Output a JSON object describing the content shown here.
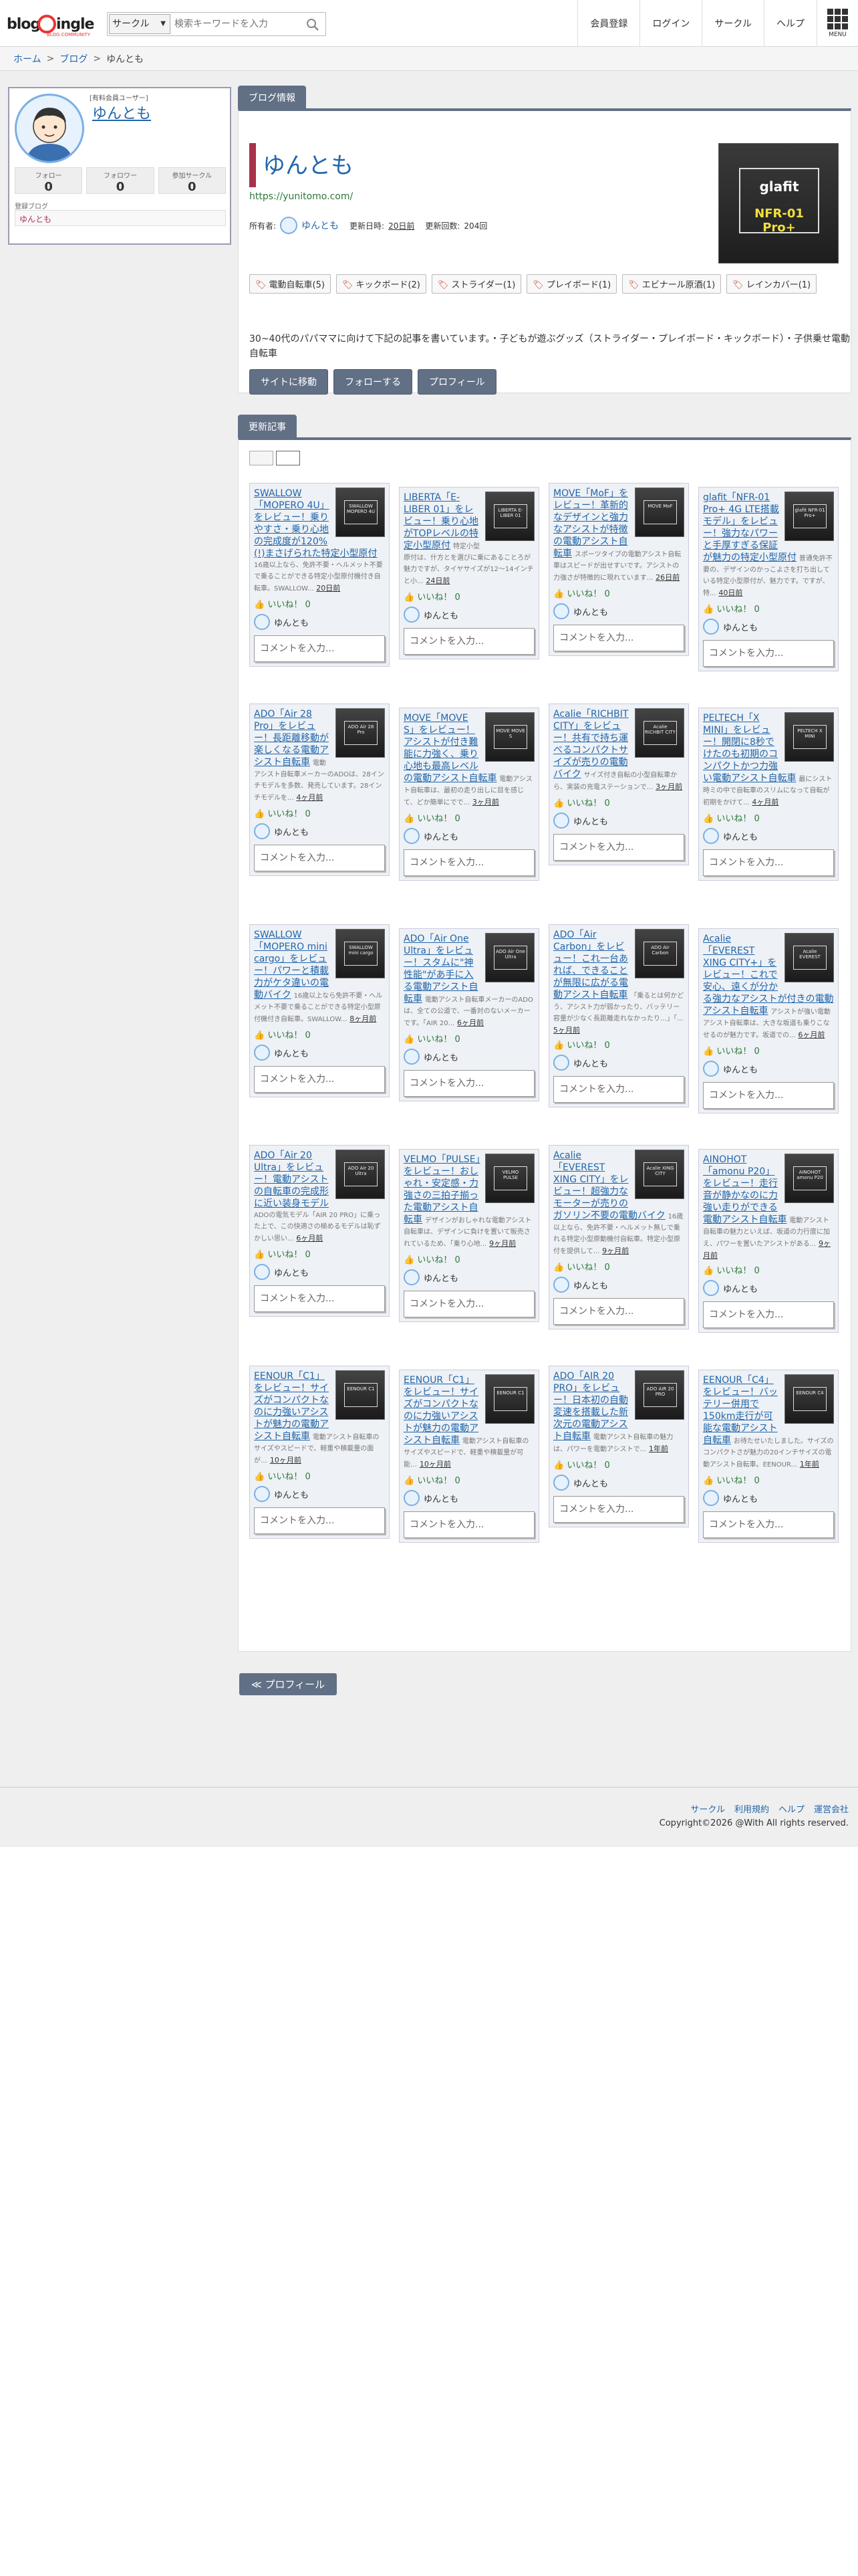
{
  "header": {
    "logo_text_left": "blog",
    "logo_text_right": "ingle",
    "logo_sub": "BLOG COMMUNITY",
    "search_select": "サークル",
    "search_placeholder": "検索キーワードを入力",
    "nav": [
      "会員登録",
      "ログイン",
      "サークル",
      "ヘルプ"
    ],
    "menu_label": "MENU"
  },
  "breadcrumb": [
    "ホーム",
    "ブログ",
    "ゆんとも"
  ],
  "profile": {
    "role": "[有料会員ユーザー]",
    "name": "ゆんとも",
    "stats": [
      {
        "label": "フォロー",
        "value": "0"
      },
      {
        "label": "フォロワー",
        "value": "0"
      },
      {
        "label": "参加サークル",
        "value": "0"
      }
    ],
    "registered_label": "登録ブログ",
    "registered_blog": "ゆんとも"
  },
  "blog_info": {
    "tab": "ブログ情報",
    "title": "ゆんとも",
    "url": "https://yunitomo.com/",
    "owner_label": "所有者:",
    "owner_name": "ゆんとも",
    "updated_label": "更新日時:",
    "updated_value": "20日前",
    "count_label": "更新回数:",
    "count_value": "204回",
    "thumb_brand": "glafit",
    "thumb_model": "NFR-01 Pro+",
    "tags": [
      "電動自転車(5)",
      "キックボード(2)",
      "ストライダー(1)",
      "プレイボード(1)",
      "エビナール原酒(1)",
      "レインカバー(1)"
    ],
    "description": "30~40代のパパママに向けて下記の記事を書いています。・子どもが遊ぶグッズ（ストライダー・プレイボード・キックボード）・子供乗せ電動自転車",
    "buttons": [
      "サイトに移動",
      "フォローする",
      "プロフィール"
    ]
  },
  "updates": {
    "tab": "更新記事",
    "like_label": "いいね！",
    "like_count": "0",
    "user_name": "ゆんとも",
    "comment_placeholder": "コメントを入力...",
    "cards": [
      {
        "title": "SWALLOW「MOPERO 4U」をレビュー！乗りやすさ・乗り心地の完成度が120%(!)まさげられた特定小型原付",
        "desc": "16歳以上なら、免許不要・ヘルメット不要で乗ることができる特定小型原付機付き自転車。SWALLOW...",
        "date": "20日前",
        "thumb": "SWALLOW MOPERO 4U"
      },
      {
        "title": "LIBERTA「E-LIBER 01」をレビュー！乗り心地がTOPレベルの特定小型原付",
        "desc": "特定小型原付は、什方とを選びに乗にあることろが魅力ですが、タイヤサイズが12〜14インチと小...",
        "date": "24日前",
        "thumb": "LIBERTA E-LIBER 01"
      },
      {
        "title": "MOVE「MoF」をレビュー！革新的なデザインと強力なアシストが特徴の電動アシスト自転車",
        "desc": "スポーツタイプの電動アシスト自転車はスピードが出せすいです。アシストの力強さが特徴的に現れています...",
        "date": "26日前",
        "thumb": "MOVE MoF"
      },
      {
        "title": "glafit「NFR-01 Pro+ 4G LTE搭載モデル」をレビュー！強力なパワーと手厚すぎる保証が魅力の特定小型原付",
        "desc": "普通免許不要の、デザインのかっこよさを打ち出している特定小型原付が、魅力です。ですが、特...",
        "date": "40日前",
        "thumb": "glafit NFR-01 Pro+"
      },
      {
        "title": "ADO「Air 28 Pro」をレビュー！長距離移動が楽しくなる電動アシスト自転車",
        "desc": "電動アシスト自転車メーカーのADOは、28インチモデルを多数、発売しています。28インチモデルを...",
        "date": "4ヶ月前",
        "thumb": "ADO Air 28 Pro"
      },
      {
        "title": "MOVE「MOVE S」をレビュー！アシストが付き難能に力強く、乗り心地も最高レベルの電動アシスト自転車",
        "desc": "電動アシスト自転車は、最初の走り出しに目を感じて、どか簡単にでで...",
        "date": "3ヶ月前",
        "thumb": "MOVE MOVE S"
      },
      {
        "title": "Acalie「RICHBIT CITY」をレビュー！共有で持ち運べるコンパクトサイズが売りの電動バイク",
        "desc": "サイズ付き自転の小型自転車から、実装の充電ステーションで...",
        "date": "3ヶ月前",
        "thumb": "Acalie RICHBIT CITY"
      },
      {
        "title": "PELTECH「X MINI」をレビュー！開閉に8秒でけたのも初期のコンパクトかつ力強い電動アシスト自転車",
        "desc": "最にシスト時ミの中で自転車のスリムになって自転が初期をかけて...",
        "date": "4ヶ月前",
        "thumb": "PELTECH X MINI"
      },
      {
        "title": "SWALLOW「MOPERO mini cargo」をレビュー！パワーと積載力がケタ違いの電動バイク",
        "desc": "16歳以上なら免許不要・ヘルメット不要で乗ることができる特定小型原付機付き自転車。SWALLOW...",
        "date": "8ヶ月前",
        "thumb": "SWALLOW mini cargo"
      },
      {
        "title": "ADO「Air One Ultra」をレビュー！スタムに\"神性能\"があ手に入る電動アシスト自転車",
        "desc": "電動アシスト自転車メーカーのADOは、全ての公道で、一番対のないメーカーです。「AIR 20...",
        "date": "6ヶ月前",
        "thumb": "ADO Air One Ultra"
      },
      {
        "title": "ADO「Air Carbon」をレビュー！これ一台あれば、できることが無限に広がる電動アシスト自転車",
        "desc": "「乗るとは何かどう、アシスト力が弱かったり、バッテリー容量が少なく長距離走れなかったり…」「...",
        "date": "5ヶ月前",
        "thumb": "ADO Air Carbon"
      },
      {
        "title": "Acalie「EVEREST XING CITY+」をレビュー！これで安心、遠くが分かる強力なアシストが付きの電動アシスト自転車",
        "desc": "アシストが強い電動アシスト自転車は、大きな坂道も乗りこなせるのが魅力です。坂道での...",
        "date": "6ヶ月前",
        "thumb": "Acalie EVEREST"
      },
      {
        "title": "ADO「Air 20 Ultra」をレビュー！電動アシストの自転車の完成形に近い装身モデル",
        "desc": "ADOの電気モデル「AIR 20 PRO」に乗った上で、この快適さの極めるモデルは恥ずかしい思い...",
        "date": "6ヶ月前",
        "thumb": "ADO Air 20 Ultra"
      },
      {
        "title": "VELMO「PULSE」をレビュー！おしゃれ・安定感・力強さの三拍子揃った電動アシスト自転車",
        "desc": "デザインがおしゃれな電動アシスト自転車は、デザインに負けを置いて販売されているため、「乗り心地...",
        "date": "9ヶ月前",
        "thumb": "VELMO PULSE"
      },
      {
        "title": "Acalie「EVEREST XING CITY」をレビュー！超強力なモーターが売りのガソリン不要の電動バイク",
        "desc": "16歳以上なら、免許不要・ヘルメット無しで乗れる特定小型原動機付自転車。特定小型原付を提供して...",
        "date": "9ヶ月前",
        "thumb": "Acalie XING CITY"
      },
      {
        "title": "AINOHOT「amonu P20」をレビュー！走行音が静かなのに力強い走りができる電動アシスト自転車",
        "desc": "電動アシスト自転車の魅力といえば、坂道の力行度に加え、パワーを置いたアシストがある...",
        "date": "9ヶ月前",
        "thumb": "AINOHOT amonu P20"
      },
      {
        "title": "EENOUR「C1」をレビュー！サイズがコンパクトなのに力強いアシストが魅力の電動アシスト自転車",
        "desc": "電動アシスト自転車のサイズやスピードで、軽重や積載量の面が…",
        "date": "10ヶ月前",
        "thumb": "EENOUR C1"
      },
      {
        "title": "EENOUR「C1」をレビュー！サイズがコンパクトなのに力強いアシストが魅力の電動アシスト自転車",
        "desc": "電動アシスト自転車のサイズやスピードで、軽重や積載量が可能…",
        "date": "10ヶ月前",
        "thumb": "EENOUR C1"
      },
      {
        "title": "ADO「AIR 20 PRO」をレビュー！日本初の自動変速を搭載した新次元の電動アシスト自転車",
        "desc": "電動アシスト自転車の魅力は、パワーを電動アシストで...",
        "date": "1年前",
        "thumb": "ADO AIR 20 PRO"
      },
      {
        "title": "EENOUR「C4」をレビュー！バッテリー併用で150km走行が可能な電動アシスト自転車",
        "desc": "お待たせいたしました。サイズのコンパクトさが魅力の20インチサイズの電動アシスト自転車。EENOUR...",
        "date": "1年前",
        "thumb": "EENOUR C4"
      }
    ]
  },
  "profile_button": "≪ プロフィール",
  "footer": {
    "links": [
      "サークル",
      "利用規約",
      "ヘルプ",
      "運営会社"
    ],
    "copyright": "Copyright©2026 @With All rights reserved."
  },
  "colors": {
    "accent": "#627086",
    "link": "#2266aa",
    "title_bar": "#a8324a"
  }
}
